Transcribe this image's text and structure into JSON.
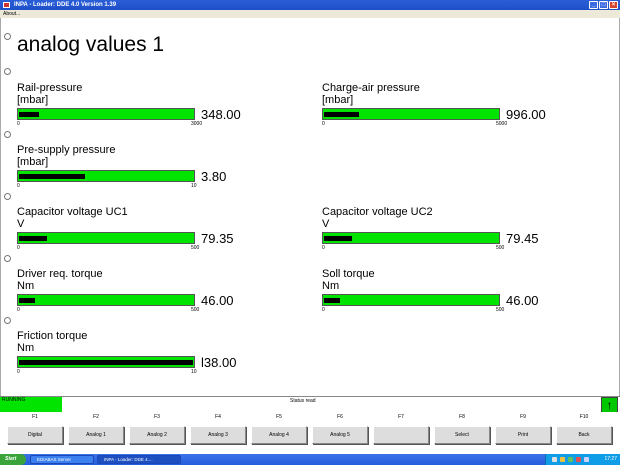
{
  "window": {
    "title": "INPA - Loader: DDE 4.0 Version 1.39"
  },
  "menubar": {
    "about_label": "About..."
  },
  "page": {
    "title": "analog values 1"
  },
  "gauges": [
    {
      "label": "Rail-pressure",
      "unit": "[mbar]",
      "value": "348.00",
      "min": "0",
      "max": "3000",
      "level": 0.116
    },
    {
      "label": "Charge-air pressure",
      "unit": "[mbar]",
      "value": "996.00",
      "min": "0",
      "max": "5000",
      "level": 0.2
    },
    {
      "label": "Pre-supply pressure",
      "unit": "[mbar]",
      "value": "3.80",
      "min": "0",
      "max": "10",
      "level": 0.38
    },
    {
      "label": "Capacitor voltage UC1",
      "unit": "V",
      "value": "79.35",
      "min": "0",
      "max": "500",
      "level": 0.159
    },
    {
      "label": "Capacitor voltage UC2",
      "unit": "V",
      "value": "79.45",
      "min": "0",
      "max": "500",
      "level": 0.159
    },
    {
      "label": "Driver req. torque",
      "unit": "Nm",
      "value": "46.00",
      "min": "0",
      "max": "500",
      "level": 0.092
    },
    {
      "label": "Soll torque",
      "unit": "Nm",
      "value": "46.00",
      "min": "0",
      "max": "500",
      "level": 0.092
    },
    {
      "label": "Friction torque",
      "unit": "Nm",
      "value": "l38.00",
      "min": "0",
      "max": "10",
      "level": 1.0
    }
  ],
  "status": {
    "running": "RUNNING",
    "text": "Status read"
  },
  "fkeys": [
    {
      "key": "F1",
      "label": "Digital"
    },
    {
      "key": "F2",
      "label": "Analog 1"
    },
    {
      "key": "F3",
      "label": "Analog 2"
    },
    {
      "key": "F4",
      "label": "Analog 3"
    },
    {
      "key": "F5",
      "label": "Analog 4"
    },
    {
      "key": "F6",
      "label": "Analog 5"
    },
    {
      "key": "F7",
      "label": ""
    },
    {
      "key": "F8",
      "label": "Select"
    },
    {
      "key": "F9",
      "label": "Print"
    },
    {
      "key": "F10",
      "label": "Back"
    }
  ],
  "taskbar": {
    "start_label": "Start",
    "tasks": [
      "EDIABAS Server",
      "INPA - Loader: DDE 4...."
    ],
    "clock": "17:27"
  },
  "colors": {
    "bar_green": "#00e400",
    "titlebar_blue": "#2a5fd8"
  }
}
